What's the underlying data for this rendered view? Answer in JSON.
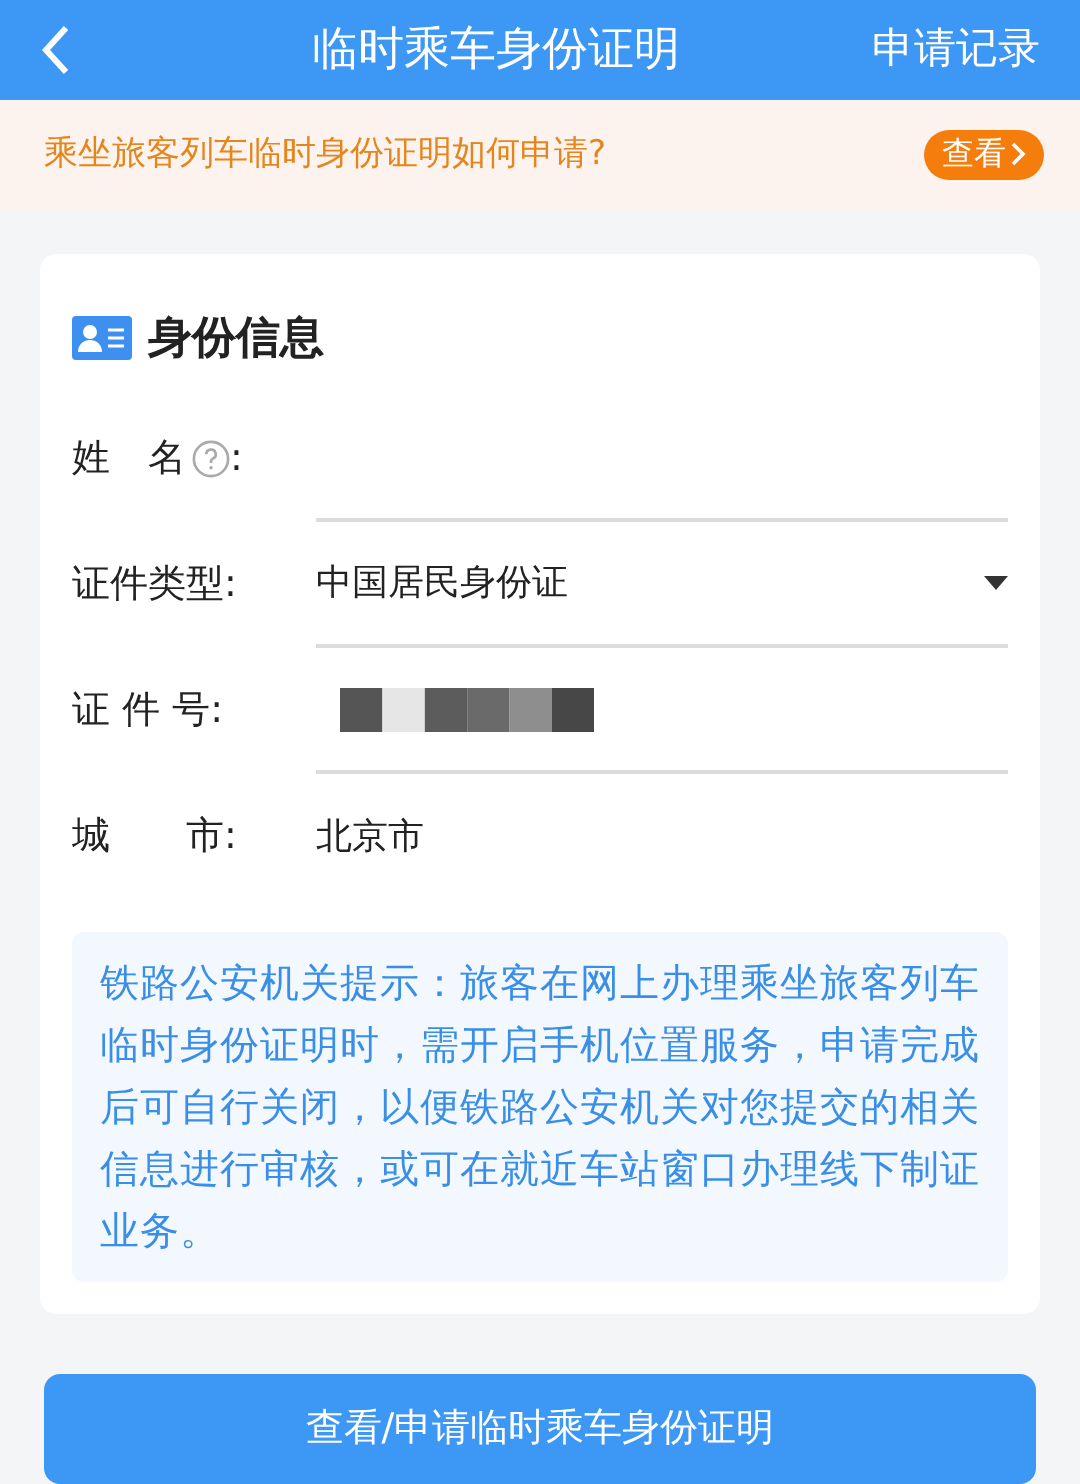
{
  "header": {
    "title": "临时乘车身份证明",
    "action": "申请记录"
  },
  "banner": {
    "text": "乘坐旅客列车临时身份证明如何申请?",
    "button": "查看"
  },
  "card": {
    "title": "身份信息",
    "rows": [
      {
        "kind": "text",
        "label": "姓　名",
        "help": true,
        "colon": ":",
        "divider": true
      },
      {
        "kind": "select",
        "label": "证件类型:",
        "help": false,
        "value": "中国居民身份证",
        "divider": true
      },
      {
        "kind": "masked",
        "label": "证 件 号:",
        "help": false,
        "divider": true
      },
      {
        "kind": "text",
        "label": "城　　市:",
        "help": false,
        "value": "北京市",
        "divider": false
      }
    ],
    "notice": "铁路公安机关提示：旅客在网上办理乘坐旅客列车临时身份证明时，需开启手机位置服务，申请完成后可自行关闭，以便铁路公安机关对您提交的相关信息进行审核，或可在就近车站窗口办理线下制证业务。"
  },
  "submit": "查看/申请临时乘车身份证明"
}
